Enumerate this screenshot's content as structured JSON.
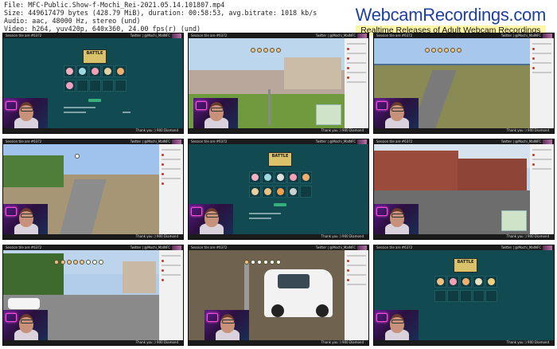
{
  "header": {
    "line1": "File: MFC-Public.Show-f-Mochi_Rei-2021.05.14.101807.mp4",
    "line2": "Size: 449617479 bytes (428.79 MiB), duration: 00:58:53, avg.bitrate: 1018 kb/s",
    "line3": "Audio: aac, 48000 Hz, stereo (und)",
    "line4": "Video: h264, yuv420p, 640x360, 24.00 fps(r) (und)"
  },
  "brand": {
    "name": "WebcamRecordings.com",
    "tagline": "Realtime Releases of Adult Webcam Recordings"
  },
  "overlay": {
    "top_left": "Session tile are #6372",
    "top_right": "Twitter | @Mochi_MaINFC",
    "bottom": "Thank you :) 900 Diamond",
    "logo": "BATTLE"
  },
  "thumbnails": [
    {
      "scene": "game-lobby"
    },
    {
      "scene": "street-fence"
    },
    {
      "scene": "coast-road"
    },
    {
      "scene": "country-road"
    },
    {
      "scene": "game-lobby"
    },
    {
      "scene": "brick-street"
    },
    {
      "scene": "town-road"
    },
    {
      "scene": "white-car"
    },
    {
      "scene": "game-lobby"
    }
  ],
  "colors": {
    "lobby_bg": "#124a52",
    "brand_blue": "#1f3f9c",
    "tagline_bg": "#fff6a8"
  }
}
